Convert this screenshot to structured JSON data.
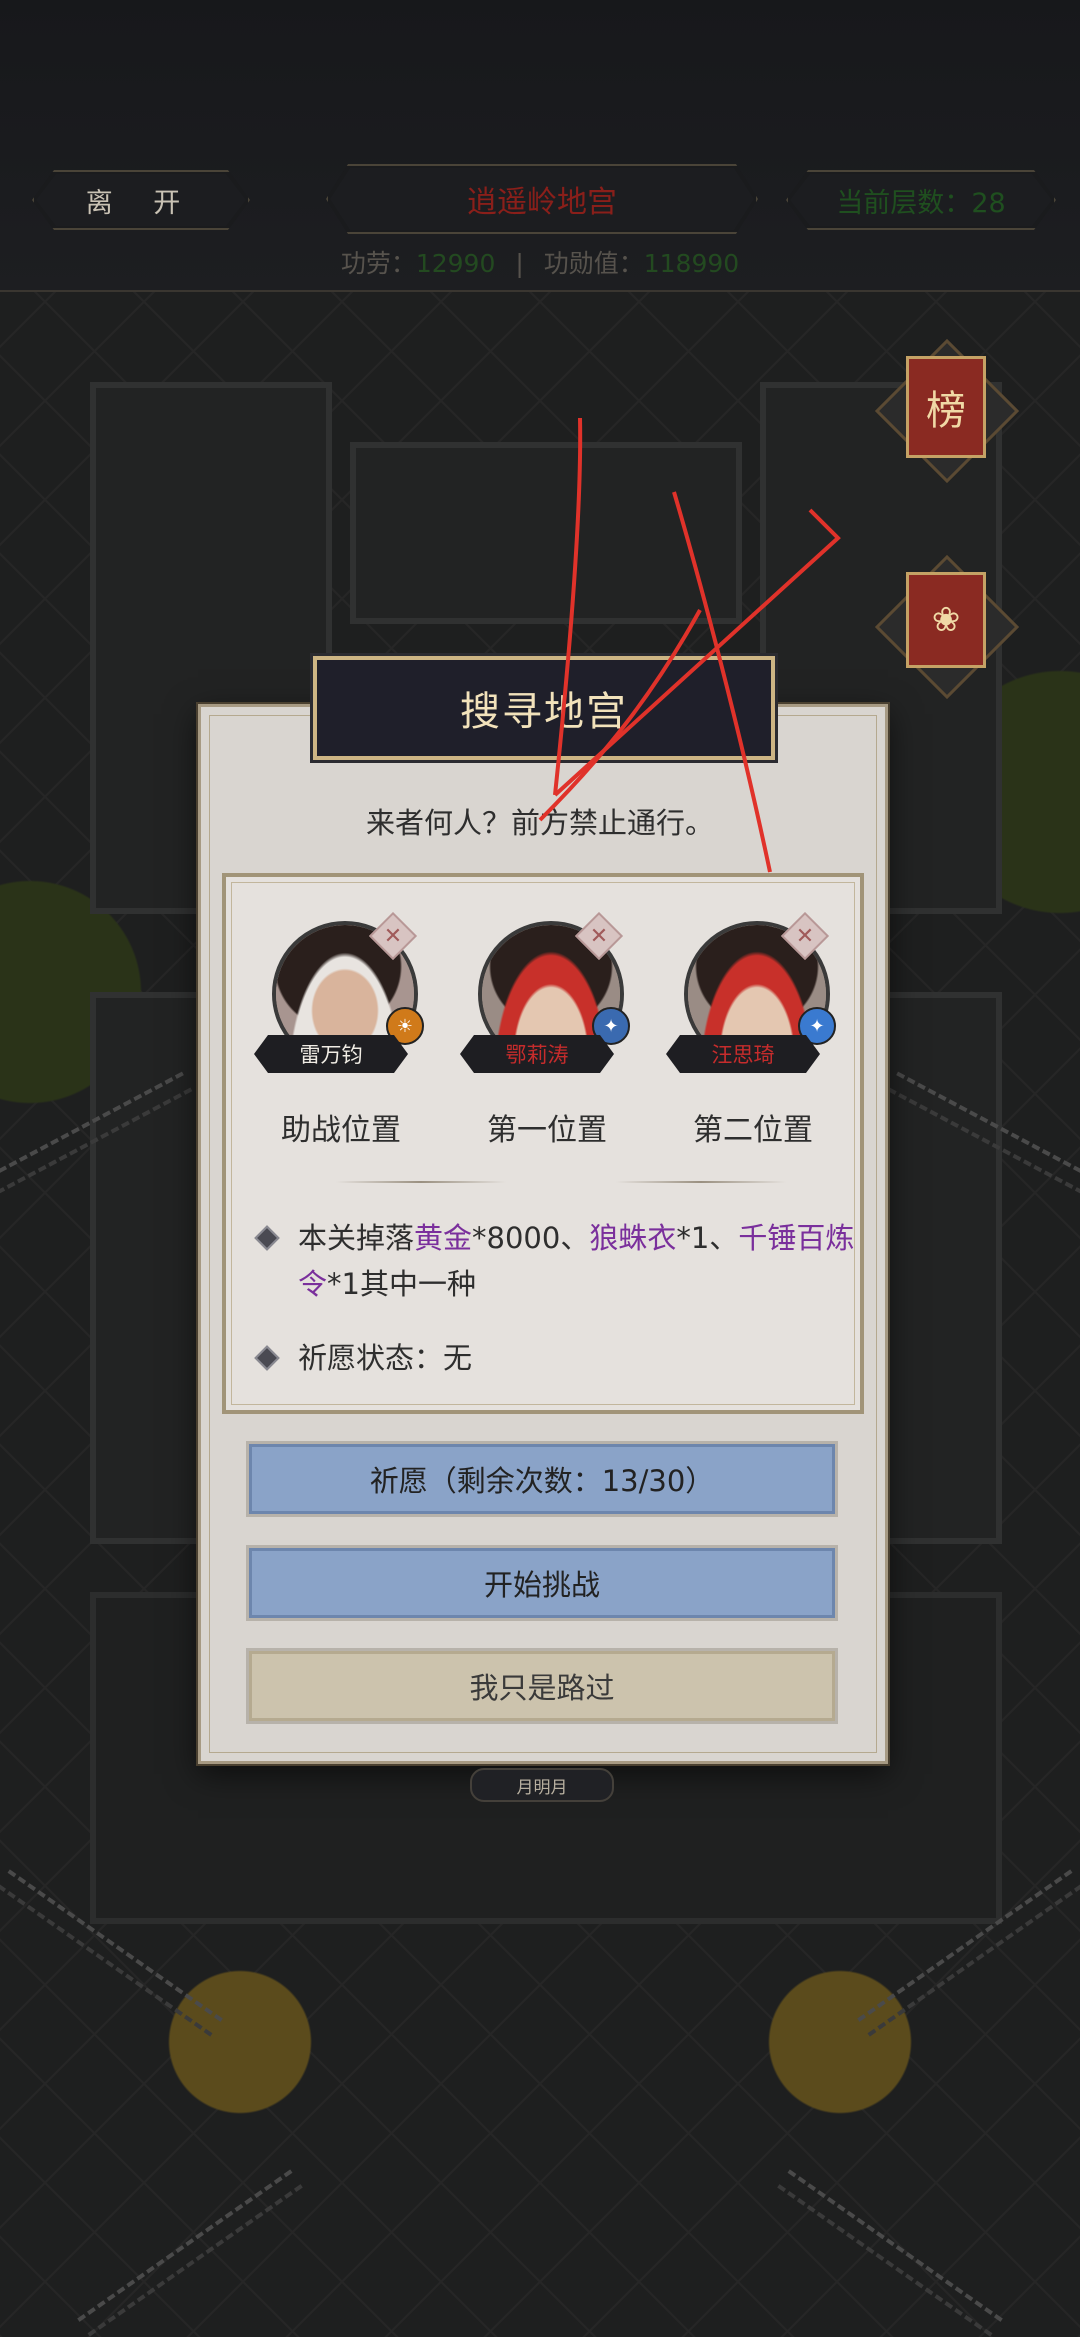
{
  "topbar": {
    "leave_label": "离 开",
    "title": "逍遥岭地宫",
    "floor_label": "当前层数：",
    "floor_value": "28",
    "merit_label": "功劳：",
    "merit_value": "12990",
    "divider": "|",
    "honor_label": "功勋值：",
    "honor_value": "118990"
  },
  "side_buttons": {
    "rank_char": "榜",
    "lotus_char": "❀"
  },
  "dialog": {
    "title": "搜寻地宫",
    "greeting": "来者何人？前方禁止通行。",
    "heroes": [
      {
        "name": "雷万钧",
        "slot": "助战位置",
        "close": "✕",
        "badge": "☀",
        "badge_color": "#d07a1a",
        "name_color": "#f0ece4"
      },
      {
        "name": "鄂莉涛",
        "slot": "第一位置",
        "close": "✕",
        "badge": "✦",
        "badge_color": "#3a6ab0",
        "name_color": "#c62c2c"
      },
      {
        "name": "汪思琦",
        "slot": "第二位置",
        "close": "✕",
        "badge": "✦",
        "badge_color": "#3a7ad0",
        "name_color": "#c62c2c"
      }
    ],
    "drop": {
      "prefix": "本关掉落",
      "item1": "黄金",
      "qty1": "*8000、",
      "item2": "狼蛛衣",
      "qty2": "*1、",
      "item3": "千锤百炼令",
      "qty3": "*1",
      "suffix": "其中一种"
    },
    "wish_status": {
      "label": "祈愿状态：",
      "value": "无"
    },
    "buttons": {
      "wish": "祈愿（剩余次数：13/30）",
      "challenge": "开始挑战",
      "pass": "我只是路过"
    }
  },
  "hint_label": "月明月",
  "colors": {
    "accent_purple": "#7a2f9c",
    "button_blue": "#8aa3c8",
    "button_beige": "#ccc3ad",
    "title_red": "#8a1f1a",
    "annotation_red": "#e0322a"
  }
}
